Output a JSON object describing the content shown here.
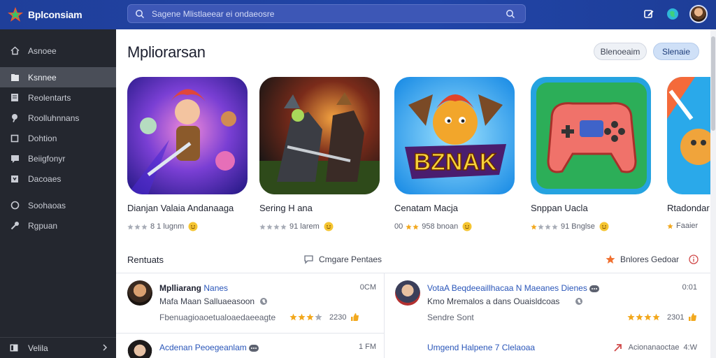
{
  "app": {
    "name": "Bplconsiam",
    "search_placeholder": "Sagene Mlistlaeear ei ondaeosre"
  },
  "colors": {
    "topbar": "#2145a8",
    "sidebar": "#24272f",
    "sidebar_active": "#4a4e58",
    "link": "#2a56b9",
    "star": "#f2a81d"
  },
  "top_icons": [
    "edit-icon",
    "globe-icon",
    "user-avatar"
  ],
  "sidebar": {
    "items": [
      {
        "label": "Asnoee",
        "icon": "home-icon"
      },
      {
        "label": "Ksnnee",
        "icon": "folder-icon",
        "active": true
      },
      {
        "label": "Reolentarts",
        "icon": "document-icon"
      },
      {
        "label": "Roolluhnnans",
        "icon": "pin-icon"
      },
      {
        "label": "Dohtion",
        "icon": "cube-icon"
      },
      {
        "label": "Beiigfonyr",
        "icon": "chat-icon"
      },
      {
        "label": "Dacoaes",
        "icon": "download-icon"
      },
      {
        "label": "Soohaoas",
        "icon": "globe-icon"
      },
      {
        "label": "Rgpuan",
        "icon": "wrench-icon"
      }
    ],
    "footer_label": "Velila"
  },
  "main": {
    "title": "Mpliorarsan",
    "pill_buttons": [
      "Blenoeaim",
      "Slenaie"
    ],
    "cards": [
      {
        "title": "Dianjan Valaia Andanaaga",
        "rating_text": "8 1 lugnm",
        "stars": 2
      },
      {
        "title": "Sering H ana",
        "rating_text": "91 larem",
        "stars": 4
      },
      {
        "title": "Cenatam Macja",
        "rating_prefix": "00",
        "rating_text": "958 bnoan",
        "stars": 2
      },
      {
        "title": "Snppan Uacla",
        "rating_text": "91 Bnglse",
        "stars": 2
      },
      {
        "title": "Rtadondar",
        "rating_text": "Faaier",
        "stars": 1
      }
    ],
    "reviews_section": {
      "title": "Rentuats",
      "compare_label": "Cmgare  Pentaes",
      "explore_label": "Bnlores Gedoar"
    },
    "reviews": [
      {
        "name": "Mplliarang",
        "name_link": "Nanes",
        "time": "0CM",
        "subtitle": "Mafa Maan Salluaeasoon",
        "footer": "Fbenuagioaoetualoaedaeeagte",
        "stars": 3,
        "count": "2230"
      },
      {
        "name_link": "VotaA Beqdeeaillhacaa N Maeanes Dienes",
        "time": "0:01",
        "subtitle": "Kmo Mremalos a dans Ouaisldcoas",
        "footer": "Sendre Sont",
        "stars": 4,
        "count": "2301"
      },
      {
        "name_link": "Acdenan Peoegeanlam",
        "time": "1 FM"
      },
      {
        "name_link": "Umgend Halpene 7 Clelaoaa",
        "rating_text": "Acionanaoctae",
        "count": "4:W"
      }
    ]
  }
}
